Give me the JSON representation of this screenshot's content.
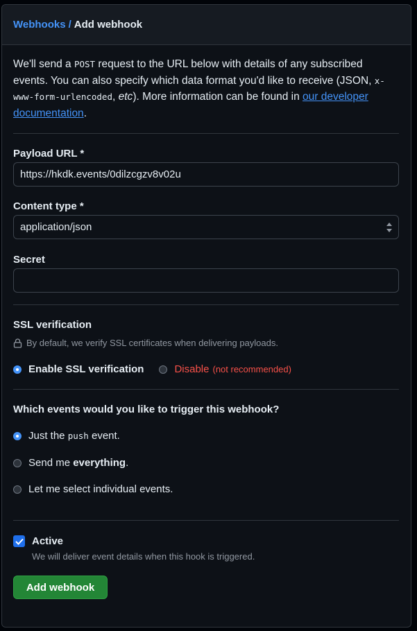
{
  "breadcrumb": {
    "parent": "Webhooks",
    "separator": "/",
    "current": "Add webhook"
  },
  "intro": {
    "part1": "We'll send a ",
    "code1": "POST",
    "part2": " request to the URL below with details of any subscribed events. You can also specify which data format you'd like to receive (JSON, ",
    "code2": "x-www-form-urlencoded",
    "part3": ", ",
    "etc": "etc",
    "part4": "). More information can be found in ",
    "link": "our developer documentation",
    "part5": "."
  },
  "payload_url": {
    "label": "Payload URL *",
    "value": "https://hkdk.events/0dilzcgzv8v02u"
  },
  "content_type": {
    "label": "Content type *",
    "value": "application/json"
  },
  "secret": {
    "label": "Secret",
    "value": ""
  },
  "ssl": {
    "title": "SSL verification",
    "helper": "By default, we verify SSL certificates when delivering payloads.",
    "enable_label": "Enable SSL verification",
    "disable_label": "Disable",
    "disable_note": "(not recommended)",
    "selected": "enable"
  },
  "events": {
    "title": "Which events would you like to trigger this webhook?",
    "options": [
      {
        "pre": "Just the ",
        "code": "push",
        "post": " event.",
        "selected": true
      },
      {
        "pre": "Send me ",
        "bold": "everything",
        "post": ".",
        "selected": false
      },
      {
        "pre": "Let me select individual events.",
        "selected": false
      }
    ]
  },
  "active": {
    "label": "Active",
    "checked": true,
    "helper": "We will deliver event details when this hook is triggered."
  },
  "submit_label": "Add webhook",
  "colors": {
    "accent": "#4493f8",
    "primary_button": "#238636",
    "danger": "#f85149",
    "background": "#0d1117"
  },
  "icons": [
    "lock-icon",
    "select-arrows-icon",
    "check-icon"
  ]
}
